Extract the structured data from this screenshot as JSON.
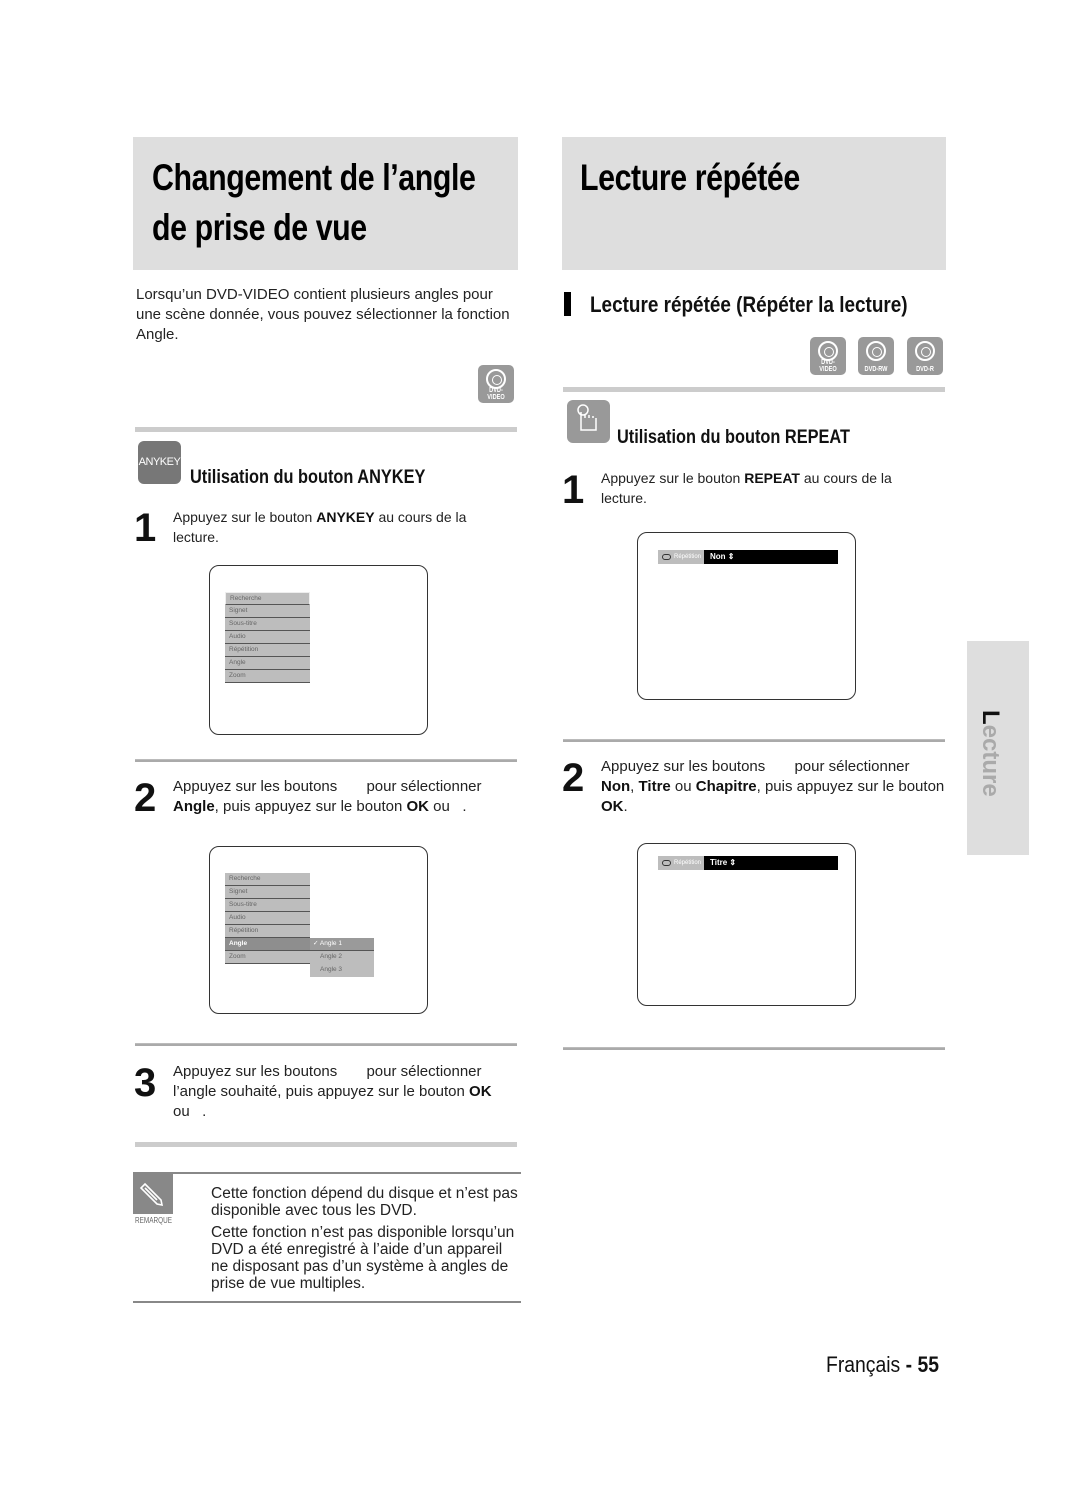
{
  "left": {
    "title_line1": "Changement de l’angle",
    "title_line2": "de prise de vue",
    "intro": "Lorsqu’un DVD-VIDEO contient plusieurs angles pour une scène donnée, vous pouvez sélectionner la fonction Angle.",
    "disc_badge": "DVD-VIDEO",
    "anykey_icon_label": "ANYKEY",
    "subheading": "Utilisation du bouton ANYKEY",
    "step1": {
      "num": "1",
      "pre": "Appuyez sur le bouton ",
      "bold": "ANYKEY",
      "post": " au cours de la lecture."
    },
    "menu1": [
      "Recherche",
      "Signet",
      "Sous-titre",
      "Audio",
      "Répétition",
      "Angle",
      "Zoom"
    ],
    "step2": {
      "num": "2",
      "line1": "Appuyez sur les boutons       pour sélectionner",
      "bold1": "Angle",
      "mid": ", puis appuyez sur le bouton ",
      "bold2": "OK",
      "post": " ou   ."
    },
    "menu2": [
      "Recherche",
      "Signet",
      "Sous-titre",
      "Audio",
      "Répétition",
      "Angle",
      "Zoom"
    ],
    "menu2_selected": "Angle",
    "submenu": [
      "Angle 1",
      "Angle 2",
      "Angle 3"
    ],
    "submenu_checked": "Angle 1",
    "step3": {
      "num": "3",
      "line1": "Appuyez sur les boutons       pour sélectionner",
      "pre": "l’angle souhaité, puis appuyez sur le bouton ",
      "bold": "OK",
      "post": "ou   ."
    },
    "note": {
      "label": "REMARQUE",
      "p1": "Cette fonction dépend du disque et n’est pas disponible avec tous les DVD.",
      "p2": "Cette fonction n’est pas disponible lorsqu’un DVD a été enregistré à l’aide d’un appareil ne disposant pas d’un système à angles de prise de vue multiples."
    }
  },
  "right": {
    "title": "Lecture répétée",
    "section_heading": "Lecture répétée (Répéter la lecture)",
    "disc_badges": [
      "DVD-VIDEO",
      "DVD-RW",
      "DVD-R"
    ],
    "subheading": "Utilisation du bouton REPEAT",
    "step1": {
      "num": "1",
      "pre": "Appuyez sur le bouton ",
      "bold": "REPEAT",
      "post": " au cours de la lecture."
    },
    "osd1": {
      "label": "Répétition",
      "value": "Non ⇕"
    },
    "step2": {
      "num": "2",
      "line1": "Appuyez sur les boutons       pour sélectionner",
      "b1": "Non",
      "s1": ", ",
      "b2": "Titre",
      "s2": " ou ",
      "b3": "Chapitre",
      "s3": ", puis appuyez sur le bouton ",
      "b4": "OK",
      "s4": "."
    },
    "osd2": {
      "label": "Répétition",
      "value": "Titre ⇕"
    }
  },
  "side_tab": {
    "first": "L",
    "rest": "ecture"
  },
  "footer": {
    "language": "Français",
    "sep": " - ",
    "page": "55"
  }
}
